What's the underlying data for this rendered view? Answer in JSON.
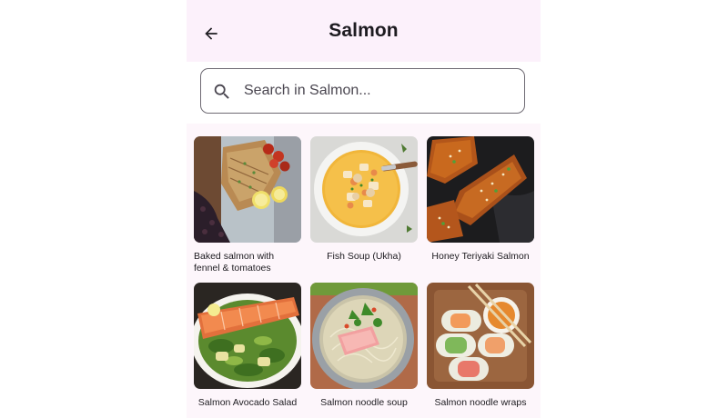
{
  "header": {
    "title": "Salmon",
    "back_icon": "arrow-left-icon"
  },
  "search": {
    "placeholder": "Search in Salmon...",
    "value": "",
    "icon": "search-icon"
  },
  "recipes": [
    {
      "name": "Baked salmon with fennel & tomatoes"
    },
    {
      "name": "Fish Soup (Ukha)"
    },
    {
      "name": "Honey Teriyaki Salmon"
    },
    {
      "name": "Salmon Avocado Salad"
    },
    {
      "name": "Salmon noodle soup"
    },
    {
      "name": "Salmon noodle wraps"
    }
  ],
  "colors": {
    "background": "#fdf7fc",
    "topbar": "#fcf1fb",
    "search_border": "#6e6a73",
    "text": "#1d1b20"
  }
}
